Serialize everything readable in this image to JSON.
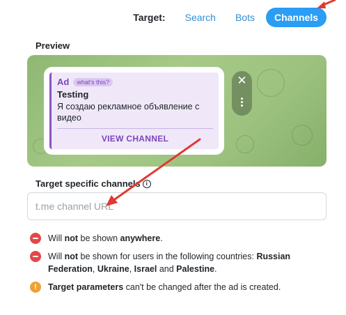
{
  "target": {
    "label": "Target:",
    "tabs": [
      {
        "label": "Search",
        "active": false
      },
      {
        "label": "Bots",
        "active": false
      },
      {
        "label": "Channels",
        "active": true
      }
    ]
  },
  "preview": {
    "title": "Preview",
    "ad": {
      "label": "Ad",
      "whats_this": "what's this?",
      "title": "Testing",
      "text": "Я создаю рекламное объявление с видео",
      "button": "VIEW CHANNEL"
    }
  },
  "channels": {
    "title": "Target specific channels",
    "placeholder": "t.me channel URL"
  },
  "notices": {
    "n1": {
      "pre": "Will ",
      "bold1": "not",
      "post": " be shown ",
      "bold2": "anywhere",
      "end": "."
    },
    "n2": {
      "pre": "Will ",
      "bold1": "not",
      "mid": " be shown for users in the following countries: ",
      "c1": "Russian Federation",
      "sep1": ", ",
      "c2": "Ukraine",
      "sep2": ", ",
      "c3": "Israel",
      "and": " and ",
      "c4": "Palestine",
      "end": "."
    },
    "n3": {
      "bold": "Target parameters",
      "rest": " can't be changed after the ad is created."
    }
  },
  "colors": {
    "accent": "#2a9df4",
    "ad_purple": "#7b45bd",
    "arrow": "#e03a32"
  }
}
